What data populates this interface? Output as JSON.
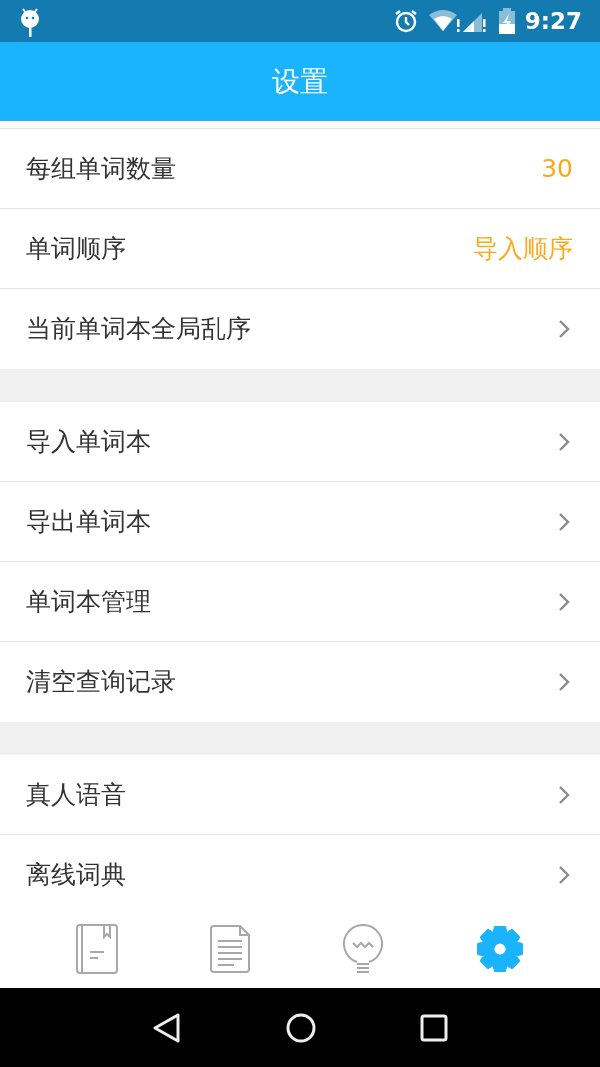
{
  "status_bar": {
    "time": "9:27"
  },
  "app_bar": {
    "title": "设置"
  },
  "groups": [
    {
      "items": [
        {
          "label": "每组单词数量",
          "kind": "value",
          "value": "30"
        },
        {
          "label": "单词顺序",
          "kind": "value",
          "value": "导入顺序"
        },
        {
          "label": "当前单词本全局乱序",
          "kind": "chevron"
        }
      ]
    },
    {
      "items": [
        {
          "label": "导入单词本",
          "kind": "chevron"
        },
        {
          "label": "导出单词本",
          "kind": "chevron"
        },
        {
          "label": "单词本管理",
          "kind": "chevron"
        },
        {
          "label": "清空查询记录",
          "kind": "chevron"
        }
      ]
    },
    {
      "items": [
        {
          "label": "真人语音",
          "kind": "chevron"
        },
        {
          "label": "离线词典",
          "kind": "chevron"
        }
      ]
    }
  ],
  "bottom_nav": [
    {
      "kind": "book",
      "selected": false
    },
    {
      "kind": "document",
      "selected": false
    },
    {
      "kind": "bulb",
      "selected": false
    },
    {
      "kind": "gear",
      "selected": true
    }
  ]
}
